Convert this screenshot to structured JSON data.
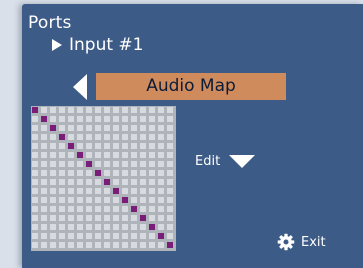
{
  "header": {
    "title": "Ports",
    "breadcrumb": "Input #1"
  },
  "section": {
    "label": "Audio Map",
    "back_icon": "left-triangle-icon"
  },
  "matrix": {
    "rows": 16,
    "cols": 16,
    "routes": [
      [
        0,
        0
      ],
      [
        1,
        1
      ],
      [
        2,
        2
      ],
      [
        3,
        3
      ],
      [
        4,
        4
      ],
      [
        5,
        5
      ],
      [
        6,
        6
      ],
      [
        7,
        7
      ],
      [
        8,
        8
      ],
      [
        9,
        9
      ],
      [
        10,
        10
      ],
      [
        11,
        11
      ],
      [
        12,
        12
      ],
      [
        13,
        13
      ],
      [
        14,
        14
      ],
      [
        15,
        15
      ]
    ],
    "active_color": "#7a1d78"
  },
  "edit": {
    "label": "Edit",
    "icon": "down-triangle-icon"
  },
  "exit": {
    "label": "Exit",
    "icon": "gear-icon"
  },
  "colors": {
    "background": "#3d5b87",
    "section_bar": "#cf8b5c",
    "section_text": "#0b1c3a"
  }
}
